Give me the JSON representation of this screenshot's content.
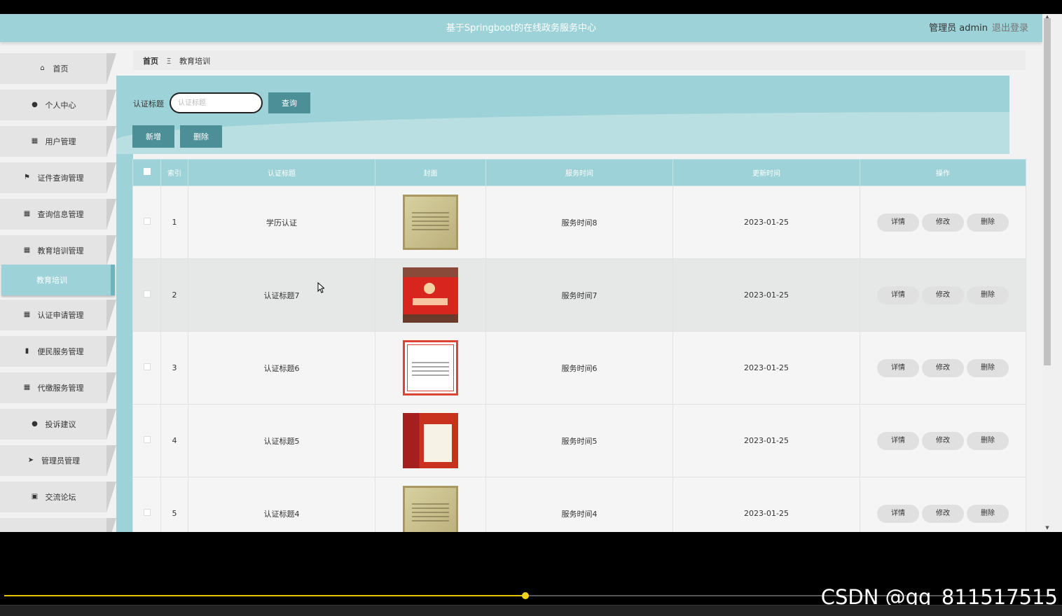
{
  "header": {
    "title": "基于Springboot的在线政务服务中心",
    "user": "管理员 admin",
    "logout": "退出登录"
  },
  "sidebar": {
    "items": [
      {
        "label": "首页",
        "icon": "home-icon"
      },
      {
        "label": "个人中心",
        "icon": "user-icon"
      },
      {
        "label": "用户管理",
        "icon": "grid-icon"
      },
      {
        "label": "证件查询管理",
        "icon": "flag-icon"
      },
      {
        "label": "查询信息管理",
        "icon": "grid-icon"
      },
      {
        "label": "教育培训管理",
        "icon": "grid-icon"
      },
      {
        "label": "认证申请管理",
        "icon": "grid-icon"
      },
      {
        "label": "便民服务管理",
        "icon": "bar-chart-icon"
      },
      {
        "label": "代缴服务管理",
        "icon": "grid-icon"
      },
      {
        "label": "投诉建议",
        "icon": "user-icon"
      },
      {
        "label": "管理员管理",
        "icon": "send-icon"
      },
      {
        "label": "交流论坛",
        "icon": "clipboard-icon"
      }
    ],
    "active_sub": "教育培训"
  },
  "breadcrumb": {
    "home": "首页",
    "separator": "Ξ",
    "current": "教育培训"
  },
  "search": {
    "label": "认证标题",
    "placeholder": "认证标题",
    "query_button": "查询",
    "add_button": "新增",
    "delete_button": "删除"
  },
  "table": {
    "columns": [
      "索引",
      "认证标题",
      "封面",
      "服务时间",
      "更新时间",
      "操作"
    ],
    "rows": [
      {
        "index": "1",
        "title": "学历认证",
        "cover": "gold",
        "service_time": "服务时间8",
        "updated": "2023-01-25"
      },
      {
        "index": "2",
        "title": "认证标题7",
        "cover": "red",
        "service_time": "服务时间7",
        "updated": "2023-01-25"
      },
      {
        "index": "3",
        "title": "认证标题6",
        "cover": "cert",
        "service_time": "服务时间6",
        "updated": "2023-01-25"
      },
      {
        "index": "4",
        "title": "认证标题5",
        "cover": "book",
        "service_time": "服务时间5",
        "updated": "2023-01-25"
      },
      {
        "index": "5",
        "title": "认证标题4",
        "cover": "gold",
        "service_time": "服务时间4",
        "updated": "2023-01-25"
      }
    ],
    "actions": {
      "detail": "详情",
      "edit": "修改",
      "delete": "删除"
    }
  },
  "player": {
    "progress": 0.496,
    "watermark": "CSDN @qq_811517515",
    "accent": "#e8c400"
  },
  "colors": {
    "primary": "#9dd2d8",
    "button": "#4d8f97"
  }
}
